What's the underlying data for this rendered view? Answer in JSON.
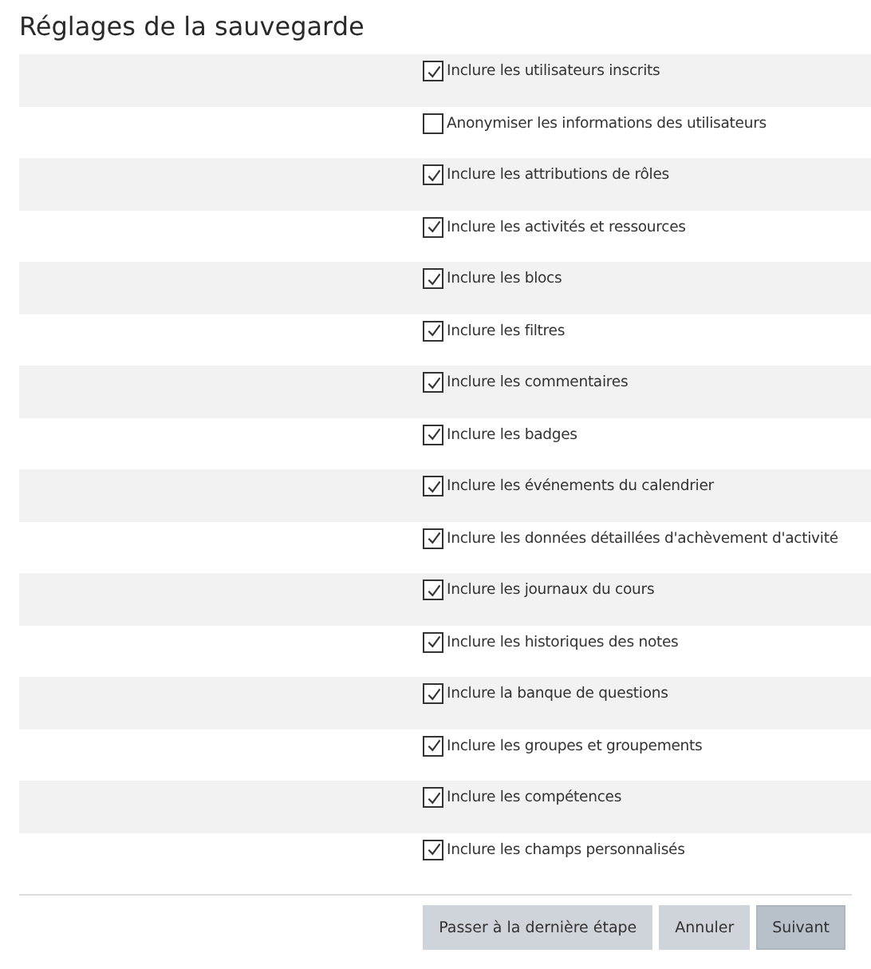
{
  "title": "Réglages de la sauvegarde",
  "settings": [
    {
      "label": "Inclure les utilisateurs inscrits",
      "checked": true
    },
    {
      "label": "Anonymiser les informations des utilisateurs",
      "checked": false
    },
    {
      "label": "Inclure les attributions de rôles",
      "checked": true
    },
    {
      "label": "Inclure les activités et ressources",
      "checked": true
    },
    {
      "label": "Inclure les blocs",
      "checked": true
    },
    {
      "label": "Inclure les filtres",
      "checked": true
    },
    {
      "label": "Inclure les commentaires",
      "checked": true
    },
    {
      "label": "Inclure les badges",
      "checked": true
    },
    {
      "label": "Inclure les événements du calendrier",
      "checked": true
    },
    {
      "label": "Inclure les données détaillées d'achèvement d'activité",
      "checked": true
    },
    {
      "label": "Inclure les journaux du cours",
      "checked": true
    },
    {
      "label": "Inclure les historiques des notes",
      "checked": true
    },
    {
      "label": "Inclure la banque de questions",
      "checked": true
    },
    {
      "label": "Inclure les groupes et groupements",
      "checked": true
    },
    {
      "label": "Inclure les compétences",
      "checked": true
    },
    {
      "label": "Inclure les champs personnalisés",
      "checked": true
    }
  ],
  "buttons": [
    {
      "label": "Passer à la dernière étape",
      "hovered": false
    },
    {
      "label": "Annuler",
      "hovered": false
    },
    {
      "label": "Suivant",
      "hovered": true
    }
  ]
}
